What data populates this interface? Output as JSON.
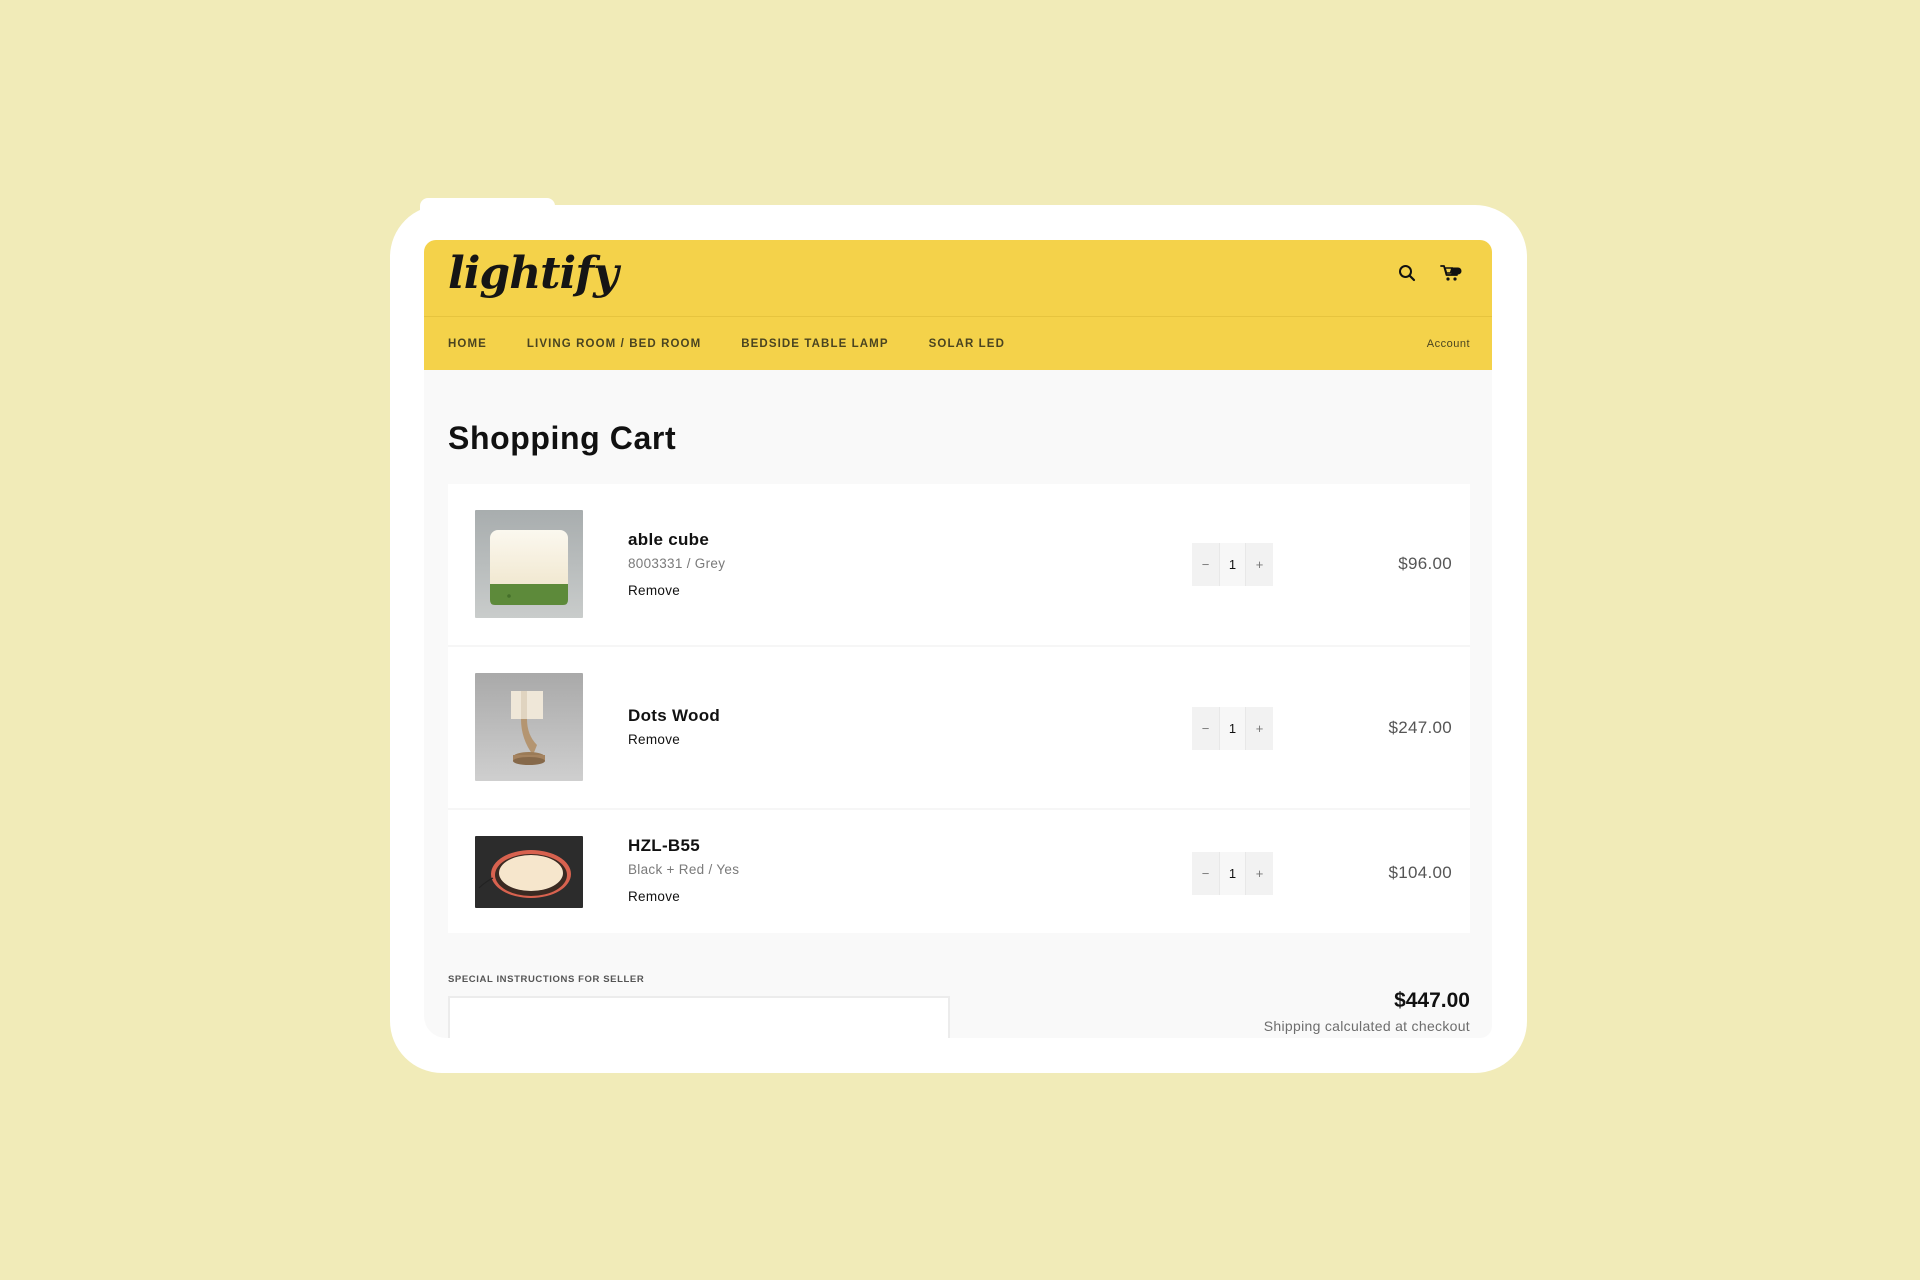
{
  "store": {
    "logo_text": "lightify",
    "brand_color": "#f4d24a",
    "background_color": "#f1ebb8"
  },
  "header": {
    "icons": [
      {
        "name": "search-icon",
        "label": "Search"
      },
      {
        "name": "cart-icon",
        "label": "Cart"
      }
    ],
    "nav": [
      {
        "label": "HOME"
      },
      {
        "label": "LIVING ROOM / BED ROOM"
      },
      {
        "label": "BEDSIDE TABLE LAMP"
      },
      {
        "label": "SOLAR LED"
      }
    ],
    "account_label": "Account"
  },
  "page": {
    "title": "Shopping Cart"
  },
  "cart": {
    "items": [
      {
        "title": "able cube",
        "variant": "8003331 / Grey",
        "remove_label": "Remove",
        "quantity": "1",
        "price": "$96.00",
        "image": "cube-lamp-image"
      },
      {
        "title": "Dots Wood",
        "variant": "",
        "remove_label": "Remove",
        "quantity": "1",
        "price": "$247.00",
        "image": "wood-lamp-image"
      },
      {
        "title": "HZL-B55",
        "variant": "Black + Red / Yes",
        "remove_label": "Remove",
        "quantity": "1",
        "price": "$104.00",
        "image": "ring-light-image"
      }
    ],
    "stepper": {
      "minus": "−",
      "plus": "+"
    },
    "instructions_label": "SPECIAL INSTRUCTIONS FOR SELLER",
    "instructions_value": "",
    "subtotal": "$447.00",
    "shipping_note": "Shipping calculated at checkout"
  }
}
